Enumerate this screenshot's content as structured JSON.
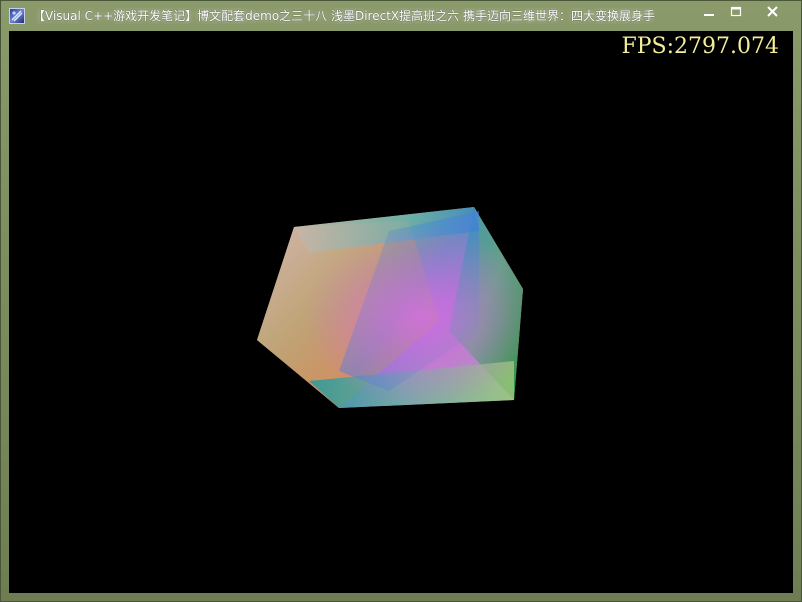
{
  "window": {
    "title": "【Visual C++游戏开发笔记】博文配套demo之三十八 浅墨DirectX提高班之六 携手迈向三维世界：四大变换展身手",
    "icon": "app-icon",
    "controls": [
      "minimize-icon",
      "maximize-icon",
      "close-icon"
    ]
  },
  "viewport": {
    "background": "#000000",
    "fps_text": "FPS:2797.074",
    "fps_color": "#f4ee9c",
    "object": "rotating-color-cube"
  },
  "colors": {
    "frame": "#7e8f5f",
    "title_text": "#ffffff"
  }
}
